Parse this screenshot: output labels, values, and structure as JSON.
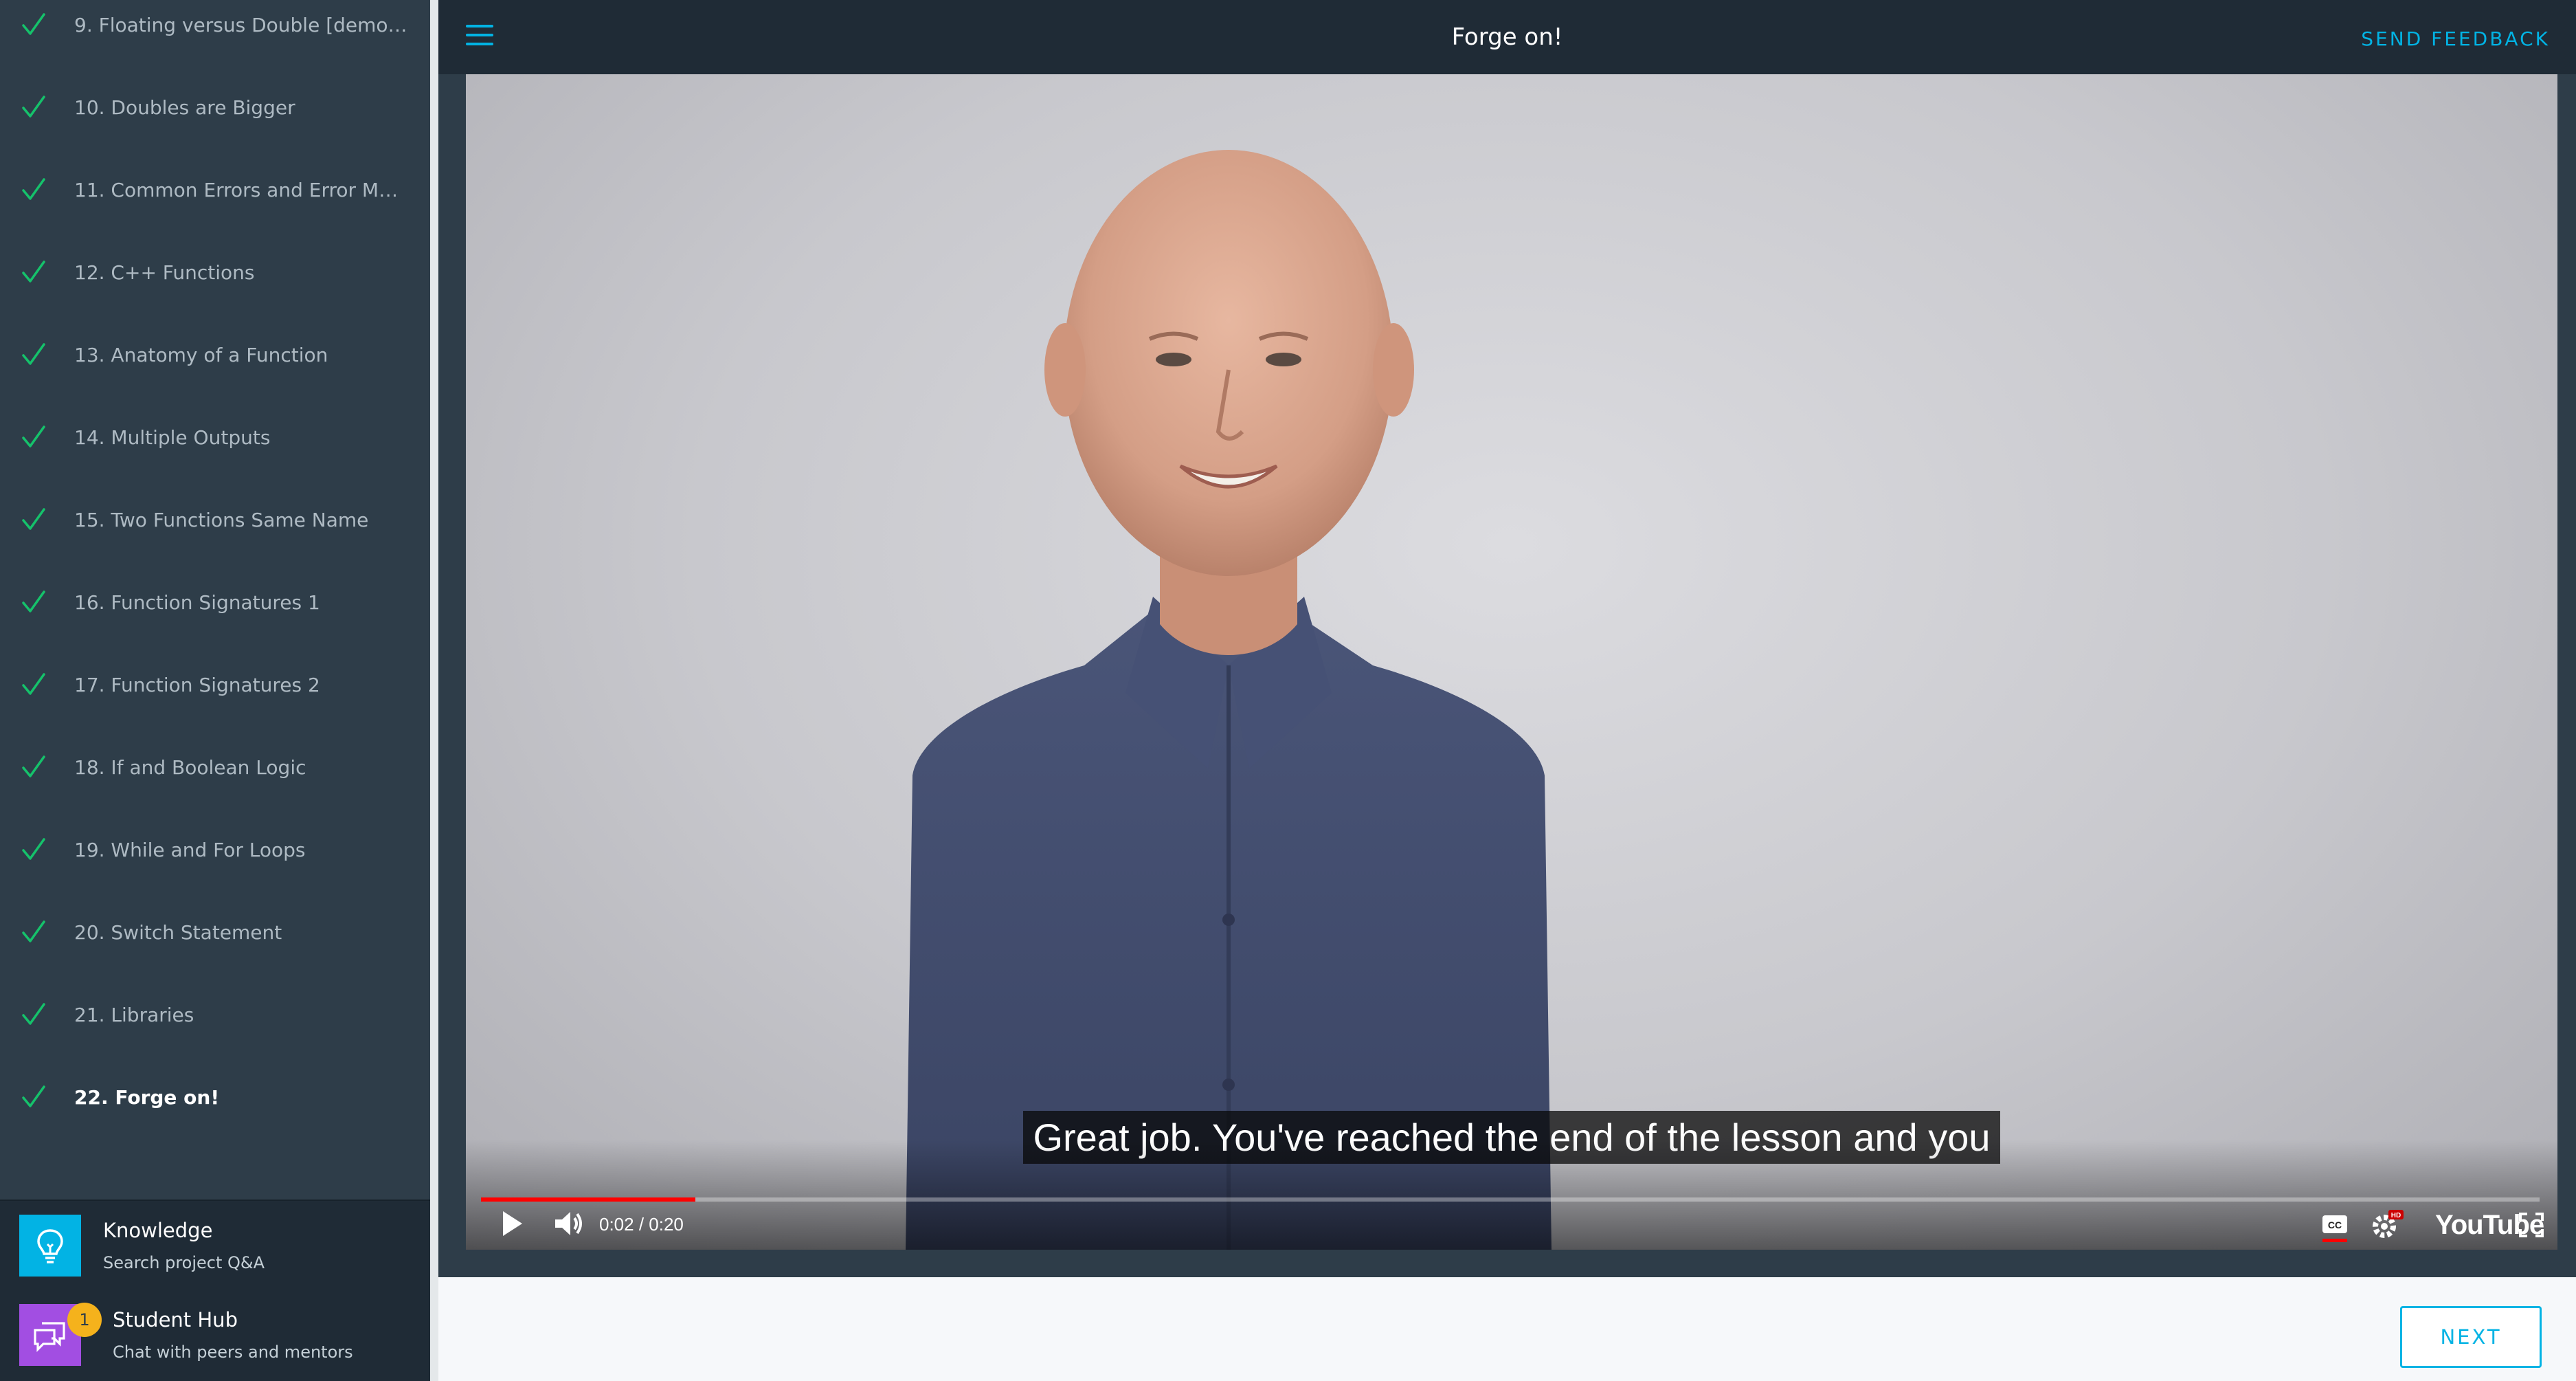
{
  "header": {
    "title": "Forge on!",
    "feedback_label": "SEND FEEDBACK"
  },
  "sidebar": {
    "lessons": [
      {
        "label": "9. Floating versus Double [demonst...",
        "completed": true
      },
      {
        "label": "10. Doubles are Bigger",
        "completed": true
      },
      {
        "label": "11. Common Errors and Error Mess...",
        "completed": true
      },
      {
        "label": "12. C++ Functions",
        "completed": true
      },
      {
        "label": "13. Anatomy of a Function",
        "completed": true
      },
      {
        "label": "14. Multiple Outputs",
        "completed": true
      },
      {
        "label": "15. Two Functions Same Name",
        "completed": true
      },
      {
        "label": "16. Function Signatures 1",
        "completed": true
      },
      {
        "label": "17. Function Signatures 2",
        "completed": true
      },
      {
        "label": "18. If and Boolean Logic",
        "completed": true
      },
      {
        "label": "19. While and For Loops",
        "completed": true
      },
      {
        "label": "20. Switch Statement",
        "completed": true
      },
      {
        "label": "21. Libraries",
        "completed": true
      },
      {
        "label": "22. Forge on!",
        "completed": true,
        "active": true
      }
    ],
    "footer": {
      "knowledge": {
        "title": "Knowledge",
        "subtitle": "Search project Q&A",
        "icon": "lightbulb-icon"
      },
      "student_hub": {
        "title": "Student Hub",
        "subtitle": "Chat with peers and mentors",
        "icon": "chat-icon",
        "badge": "1"
      }
    }
  },
  "video": {
    "caption": "Great job. You've reached the end of the lesson and you",
    "time": "0:02 / 0:20",
    "progress": 0.104,
    "logo": "YouTube"
  },
  "bottom": {
    "next_label": "NEXT"
  },
  "colors": {
    "accent": "#02b3e4",
    "sidebar_bg": "#2e3d49",
    "header_bg": "#1f2b36",
    "check": "#15c26b",
    "progress": "#ff0000"
  }
}
